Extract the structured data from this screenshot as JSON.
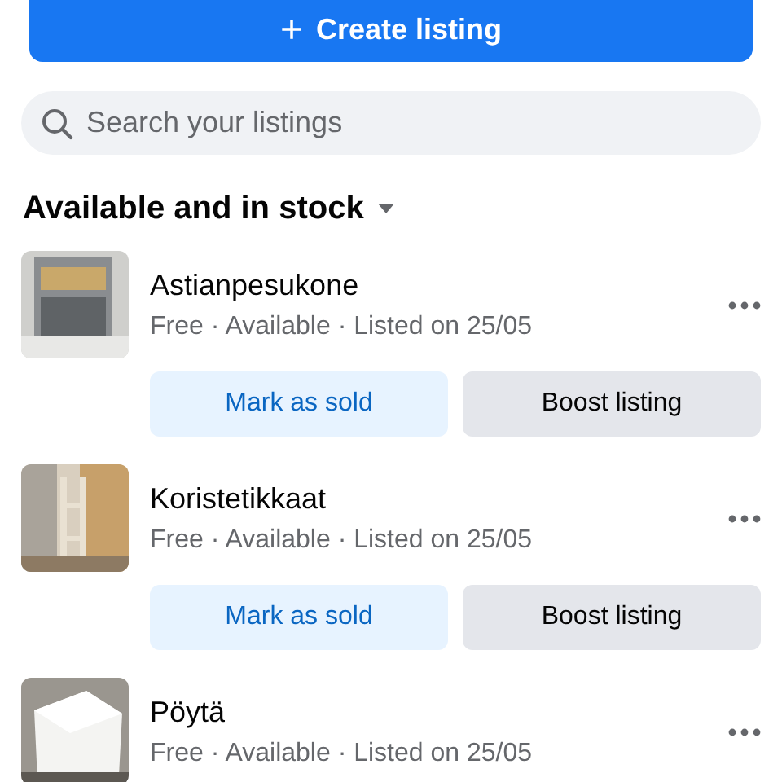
{
  "create_button": {
    "icon": "+",
    "label": "Create listing"
  },
  "search": {
    "placeholder": "Search your listings"
  },
  "section": {
    "title": "Available and in stock"
  },
  "listings": [
    {
      "title": "Astianpesukone",
      "details": "Free · Available · Listed on 25/05",
      "buttons": [
        "Mark as sold",
        "Boost listing"
      ]
    },
    {
      "title": "Koristetikkaat",
      "details": "Free · Available · Listed on 25/05",
      "buttons": [
        "Mark as sold",
        "Boost listing"
      ]
    },
    {
      "title": "Pöytä",
      "details": "Free · Available · Listed on 25/05"
    }
  ]
}
